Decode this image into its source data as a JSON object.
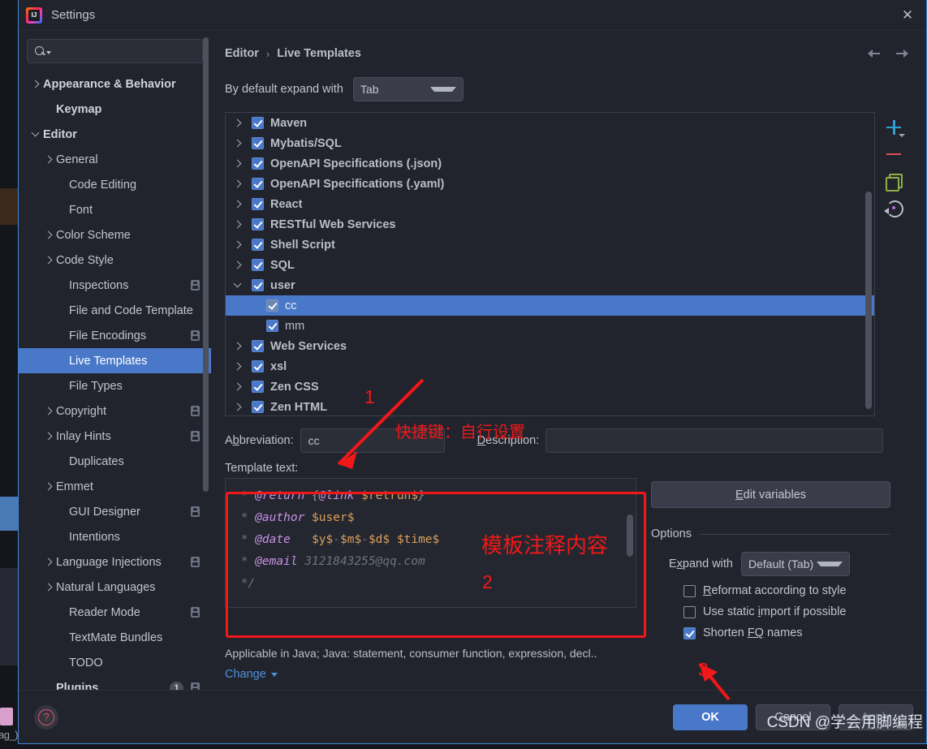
{
  "window": {
    "title": "Settings",
    "app_icon": "intellij-idea-icon",
    "close_icon": "close-icon"
  },
  "search": {
    "placeholder": "",
    "value": "",
    "icon": "search-icon"
  },
  "sidebar": {
    "items": [
      {
        "label": "Appearance & Behavior",
        "chevron": "right",
        "bold": true,
        "indent": 0,
        "badge": false
      },
      {
        "label": "Keymap",
        "chevron": "none",
        "bold": true,
        "indent": 1,
        "badge": false
      },
      {
        "label": "Editor",
        "chevron": "down",
        "bold": true,
        "indent": 0,
        "badge": false
      },
      {
        "label": "General",
        "chevron": "right",
        "bold": false,
        "indent": 1,
        "badge": false
      },
      {
        "label": "Code Editing",
        "chevron": "none",
        "bold": false,
        "indent": 2,
        "badge": false
      },
      {
        "label": "Font",
        "chevron": "none",
        "bold": false,
        "indent": 2,
        "badge": false
      },
      {
        "label": "Color Scheme",
        "chevron": "right",
        "bold": false,
        "indent": 1,
        "badge": false
      },
      {
        "label": "Code Style",
        "chevron": "right",
        "bold": false,
        "indent": 1,
        "badge": false
      },
      {
        "label": "Inspections",
        "chevron": "none",
        "bold": false,
        "indent": 2,
        "badge": true
      },
      {
        "label": "File and Code Template",
        "chevron": "none",
        "bold": false,
        "indent": 2,
        "badge": false
      },
      {
        "label": "File Encodings",
        "chevron": "none",
        "bold": false,
        "indent": 2,
        "badge": true
      },
      {
        "label": "Live Templates",
        "chevron": "none",
        "bold": false,
        "indent": 2,
        "badge": false,
        "selected": true
      },
      {
        "label": "File Types",
        "chevron": "none",
        "bold": false,
        "indent": 2,
        "badge": false
      },
      {
        "label": "Copyright",
        "chevron": "right",
        "bold": false,
        "indent": 1,
        "badge": true
      },
      {
        "label": "Inlay Hints",
        "chevron": "right",
        "bold": false,
        "indent": 1,
        "badge": true
      },
      {
        "label": "Duplicates",
        "chevron": "none",
        "bold": false,
        "indent": 2,
        "badge": false
      },
      {
        "label": "Emmet",
        "chevron": "right",
        "bold": false,
        "indent": 1,
        "badge": false
      },
      {
        "label": "GUI Designer",
        "chevron": "none",
        "bold": false,
        "indent": 2,
        "badge": true
      },
      {
        "label": "Intentions",
        "chevron": "none",
        "bold": false,
        "indent": 2,
        "badge": false
      },
      {
        "label": "Language Injections",
        "chevron": "right",
        "bold": false,
        "indent": 1,
        "badge": true
      },
      {
        "label": "Natural Languages",
        "chevron": "right",
        "bold": false,
        "indent": 1,
        "badge": false
      },
      {
        "label": "Reader Mode",
        "chevron": "none",
        "bold": false,
        "indent": 2,
        "badge": true
      },
      {
        "label": "TextMate Bundles",
        "chevron": "none",
        "bold": false,
        "indent": 2,
        "badge": false
      },
      {
        "label": "TODO",
        "chevron": "none",
        "bold": false,
        "indent": 2,
        "badge": false
      },
      {
        "label": "Plugins",
        "chevron": "none",
        "bold": true,
        "indent": 1,
        "badge": true,
        "count": "1"
      }
    ]
  },
  "breadcrumb": {
    "parent": "Editor",
    "separator": "›",
    "current": "Live Templates"
  },
  "toolbar": {
    "expand_label": "By default expand with",
    "expand_value": "Tab"
  },
  "template_list": {
    "rows": [
      {
        "label": "Maven",
        "chevron": "right",
        "checked": true,
        "child": false
      },
      {
        "label": "Mybatis/SQL",
        "chevron": "right",
        "checked": true,
        "child": false
      },
      {
        "label": "OpenAPI Specifications (.json)",
        "chevron": "right",
        "checked": true,
        "child": false
      },
      {
        "label": "OpenAPI Specifications (.yaml)",
        "chevron": "right",
        "checked": true,
        "child": false
      },
      {
        "label": "React",
        "chevron": "right",
        "checked": true,
        "child": false
      },
      {
        "label": "RESTful Web Services",
        "chevron": "right",
        "checked": true,
        "child": false
      },
      {
        "label": "Shell Script",
        "chevron": "right",
        "checked": true,
        "child": false
      },
      {
        "label": "SQL",
        "chevron": "right",
        "checked": true,
        "child": false
      },
      {
        "label": "user",
        "chevron": "down",
        "checked": true,
        "child": false
      },
      {
        "label": "cc",
        "chevron": "none",
        "checked": true,
        "child": true,
        "selected": true
      },
      {
        "label": "mm",
        "chevron": "none",
        "checked": true,
        "child": true
      },
      {
        "label": "Web Services",
        "chevron": "right",
        "checked": true,
        "child": false
      },
      {
        "label": "xsl",
        "chevron": "right",
        "checked": true,
        "child": false
      },
      {
        "label": "Zen CSS",
        "chevron": "right",
        "checked": true,
        "child": false
      },
      {
        "label": "Zen HTML",
        "chevron": "right",
        "checked": true,
        "child": false
      }
    ],
    "tools": [
      {
        "name": "add-template-button",
        "icon": "plus-icon"
      },
      {
        "name": "remove-template-button",
        "icon": "minus-icon"
      },
      {
        "name": "duplicate-template-button",
        "icon": "copy-icon"
      },
      {
        "name": "restore-defaults-button",
        "icon": "revert-icon"
      }
    ]
  },
  "fields": {
    "abbreviation_label": "Abbreviation:",
    "abbreviation_label_pre": "A",
    "abbreviation_label_key": "b",
    "abbreviation_label_post": "breviation:",
    "abbreviation_value": "cc",
    "description_label_key": "D",
    "description_label_post": "escription:",
    "description_value": "",
    "template_text_label": "Template text:"
  },
  "template_text": {
    "lines": [
      {
        "star": " * ",
        "tag": "@return",
        "space": " ",
        "brace_open": "{",
        "tag2": "@link",
        "space2": " ",
        "var": "$retrun$",
        "brace_close": "}"
      },
      {
        "star": " * ",
        "tag": "@author",
        "space": " ",
        "var": "$user$"
      },
      {
        "star": " * ",
        "tag": "@date",
        "space": "   ",
        "var": "$y$-$m$-$d$ $time$"
      },
      {
        "star": " * ",
        "tag": "@email",
        "space": " ",
        "plain": "3121843255@qq.com"
      },
      {
        "star": " */"
      }
    ],
    "raw": " * @return {@link $retrun$}\n * @author $user$\n * @date   $y$-$m$-$d$ $time$\n * @email 3121843255@qq.com\n */"
  },
  "applicable": {
    "text": "Applicable in Java; Java: statement, consumer function, expression, decl..",
    "change_label": "Change"
  },
  "options": {
    "edit_variables_key": "E",
    "edit_variables_post": "dit variables",
    "section_title": "Options",
    "expand_with_key": "Ex",
    "expand_with_label_pre": "E",
    "expand_with_label_key": "x",
    "expand_with_label_post": "pand with",
    "expand_with_value": "Default (Tab)",
    "checkboxes": [
      {
        "pre": "",
        "key": "R",
        "post": "eformat according to style",
        "checked": false,
        "name": "reformat-according-to-style-checkbox"
      },
      {
        "pre": "Use static ",
        "key": "i",
        "post": "mport if possible",
        "checked": false,
        "name": "use-static-import-checkbox"
      },
      {
        "pre": "Shorten ",
        "key": "FQ",
        "post": " names",
        "checked": true,
        "name": "shorten-fq-names-checkbox"
      }
    ]
  },
  "footer": {
    "help_icon": "help-icon",
    "ok": "OK",
    "cancel": "Cancel",
    "apply": "Apply"
  },
  "annotations": {
    "num1": "1",
    "num2": "2",
    "num3": "3",
    "text1": "快捷键：自行设置",
    "text2": "模板注释内容",
    "arrow_color": "#f01818",
    "box_color": "#f01818"
  },
  "watermark": {
    "text": "CSDN @学会用脚编程"
  },
  "behind": {
    "stray_text": "ag_)"
  },
  "colors": {
    "accent": "#4a78c8",
    "window_bg": "#22242d",
    "border": "#3e88d6",
    "annotation_red": "#f01818",
    "link_blue": "#4a90d9"
  }
}
